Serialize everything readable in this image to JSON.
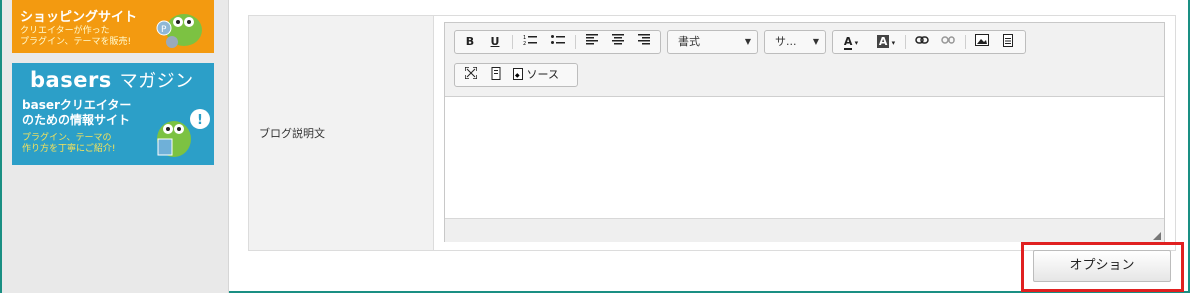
{
  "sidebar": {
    "banner_shop": {
      "title": "ショッピングサイト",
      "line1": "クリエイターが作った",
      "line2": "プラグイン、テーマを販売!"
    },
    "banner_magazine": {
      "logo": "basers",
      "logo_sub": "マガジン",
      "title1": "baserクリエイター",
      "title2": "のための情報サイト",
      "sub1": "プラグイン、テーマの",
      "sub2": "作り方を丁寧にご紹介!"
    }
  },
  "form": {
    "field_label": "ブログ説明文"
  },
  "editor": {
    "toolbar": {
      "bold": "B",
      "underline": "U",
      "format_label": "書式",
      "size_label": "サ...",
      "text_color": "A",
      "bg_color": "A",
      "source_label": "ソース"
    },
    "content": ""
  },
  "options_button": "オプション",
  "colors": {
    "frame_border": "#1a8f83",
    "highlight": "#e02020",
    "banner_orange": "#f39a10",
    "banner_blue": "#2c9fc8"
  }
}
